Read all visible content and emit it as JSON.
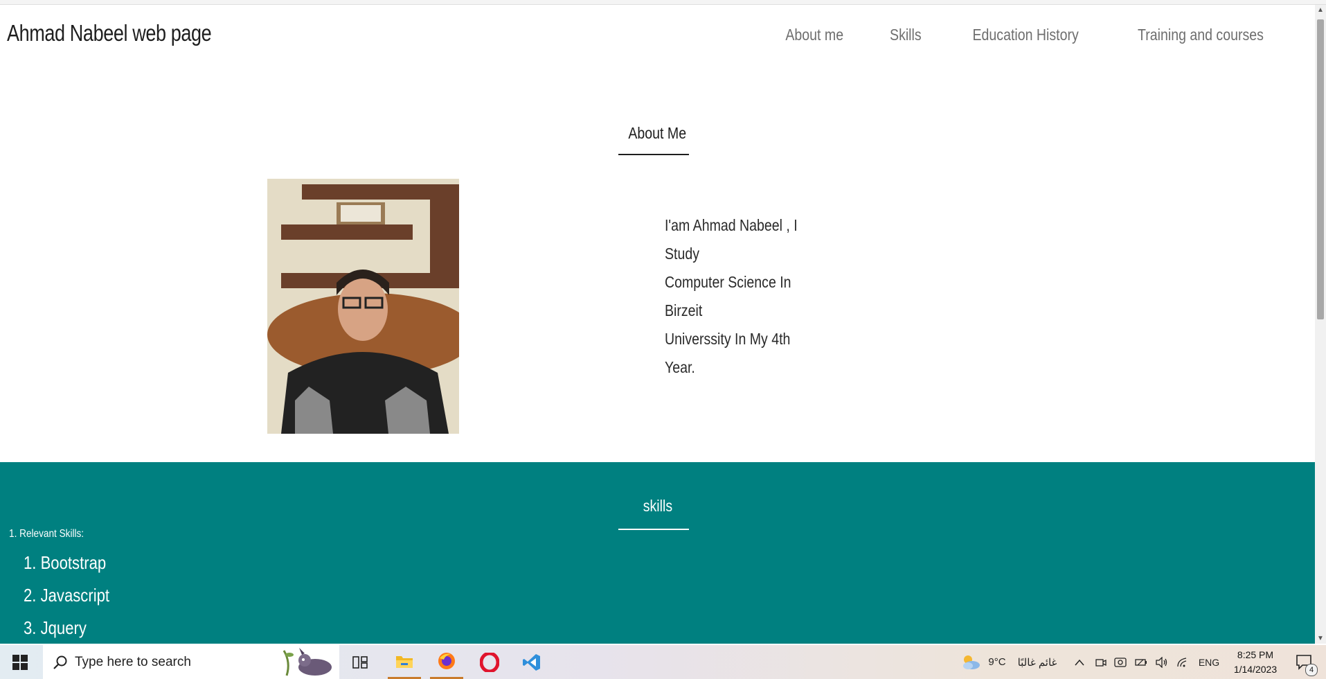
{
  "page": {
    "brand": "Ahmad Nabeel web page",
    "nav": [
      "About me",
      "Skills",
      "Education History",
      "Training and courses"
    ],
    "about": {
      "title": "About Me",
      "lines": [
        "I'am Ahmad Nabeel , I Study",
        "Computer Science In Birzeit",
        "Universsity In My 4th Year."
      ]
    },
    "skills": {
      "title": "skills",
      "relevant_label": "1. Relevant Skills:",
      "items": [
        "1. Bootstrap",
        "2. Javascript",
        "3. Jquery"
      ]
    }
  },
  "taskbar": {
    "search_placeholder": "Type here to search",
    "weather_temp": "9°C",
    "weather_desc": "غائم غالبًا",
    "language": "ENG",
    "time": "8:25 PM",
    "date": "1/14/2023",
    "notification_count": "4",
    "colors": {
      "opera": "#e0142d",
      "vscode": "#2f8fdb",
      "firefox": "#ff7a18",
      "explorer": "#f2b824"
    }
  },
  "colors": {
    "skills_bg": "#008080",
    "text_dark": "#1e1e1e",
    "nav_text": "#6e6e6e"
  }
}
